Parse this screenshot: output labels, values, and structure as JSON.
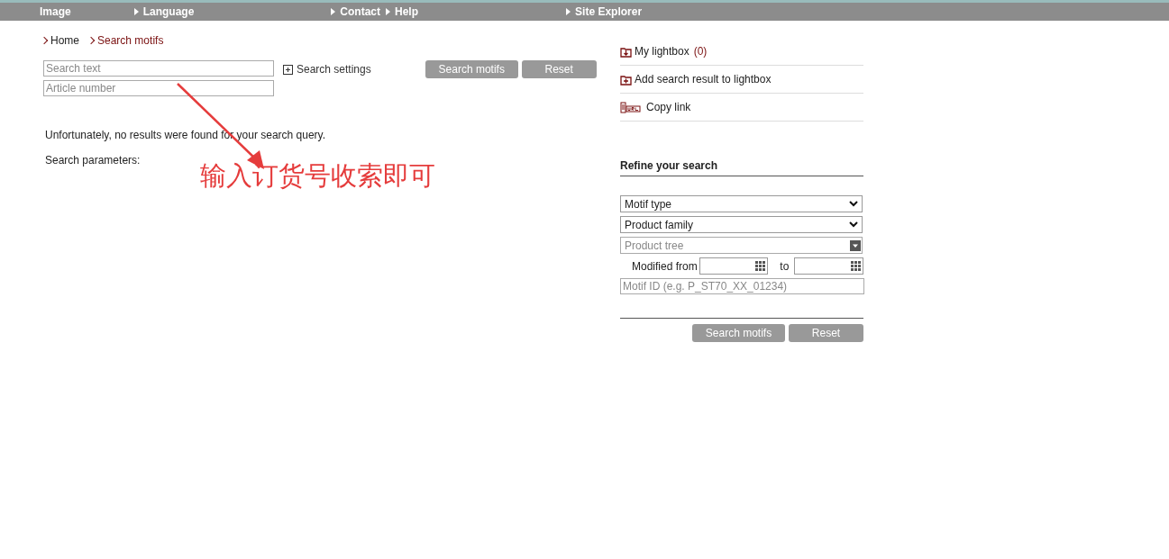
{
  "top_nav": [
    {
      "label": "Image",
      "arrow": false
    },
    {
      "label": "Language",
      "arrow": true
    },
    {
      "label": "Contact",
      "arrow": true
    },
    {
      "label": "Help",
      "arrow": true
    },
    {
      "label": "Site Explorer",
      "arrow": true
    }
  ],
  "breadcrumb": [
    {
      "label": "Home",
      "selected": false
    },
    {
      "label": "Search motifs",
      "selected": true
    }
  ],
  "search": {
    "text_placeholder": "Search text",
    "article_placeholder": "Article number",
    "settings_label": "Search settings",
    "buttons": [
      "Search motifs",
      "Reset"
    ]
  },
  "results": {
    "message": "Unfortunately, no results were found for your search query.",
    "parameters_label": "Search parameters:"
  },
  "actions": [
    {
      "kind": "lightbox",
      "label": "My lightbox",
      "count": "(0)"
    },
    {
      "kind": "add",
      "label": "Add search result to lightbox"
    },
    {
      "kind": "url",
      "label": "Copy link"
    }
  ],
  "refine": {
    "title": "Refine your search",
    "selects": [
      "Motif type",
      "Product family"
    ],
    "tree_placeholder": "Product tree",
    "modified_from_label": "Modified from",
    "to_label": "to",
    "motif_id_placeholder": "Motif ID (e.g. P_ST70_XX_01234)",
    "buttons": [
      "Search motifs",
      "Reset"
    ]
  },
  "annotation": {
    "text": "输入订货号收索即可"
  }
}
